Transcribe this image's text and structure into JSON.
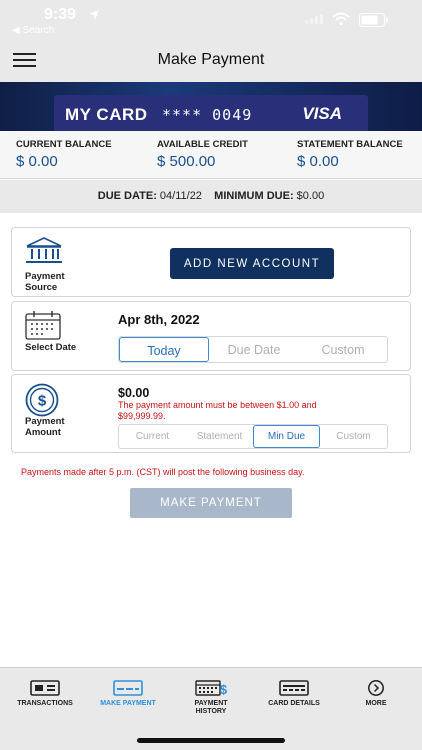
{
  "status": {
    "time": "9:39",
    "back_label": "◀ Search"
  },
  "header": {
    "title": "Make Payment"
  },
  "card": {
    "name": "MY CARD",
    "number": "**** 0049",
    "brand": "VISA"
  },
  "balances": [
    {
      "label": "CURRENT BALANCE",
      "value": "$ 0.00"
    },
    {
      "label": "AVAILABLE CREDIT",
      "value": "$ 500.00"
    },
    {
      "label": "STATEMENT BALANCE",
      "value": "$ 0.00"
    }
  ],
  "due": {
    "date_label": "DUE DATE:",
    "date_value": "04/11/22",
    "min_label": "MINIMUM DUE:",
    "min_value": "$0.00"
  },
  "payment_source": {
    "label_line1": "Payment",
    "label_line2": "Source",
    "button": "ADD NEW ACCOUNT"
  },
  "select_date": {
    "label": "Select Date",
    "date_value": "Apr 8th, 2022",
    "options": [
      "Today",
      "Due Date",
      "Custom"
    ],
    "selected": "Today"
  },
  "payment_amount": {
    "label_line1": "Payment",
    "label_line2": "Amount",
    "value": "$0.00",
    "error": "The payment amount must be between $1.00 and $99,999.99.",
    "options": [
      "Current",
      "Statement",
      "Min Due",
      "Custom"
    ],
    "selected": "Min Due"
  },
  "notice": "Payments made after 5 p.m. (CST) will post the following business day.",
  "submit_button": "MAKE PAYMENT",
  "tabs": [
    {
      "label": "TRANSACTIONS",
      "icon": "transactions-icon"
    },
    {
      "label": "MAKE PAYMENT",
      "icon": "make-payment-icon",
      "active": true
    },
    {
      "label_line1": "PAYMENT",
      "label_line2": "HISTORY",
      "icon": "payment-history-icon"
    },
    {
      "label": "CARD DETAILS",
      "icon": "card-details-icon"
    },
    {
      "label": "MORE",
      "icon": "more-icon"
    }
  ],
  "colors": {
    "accent": "#10305f",
    "link": "#1a4f8f",
    "error": "#cc1111",
    "active_tab": "#2e8fd8"
  }
}
